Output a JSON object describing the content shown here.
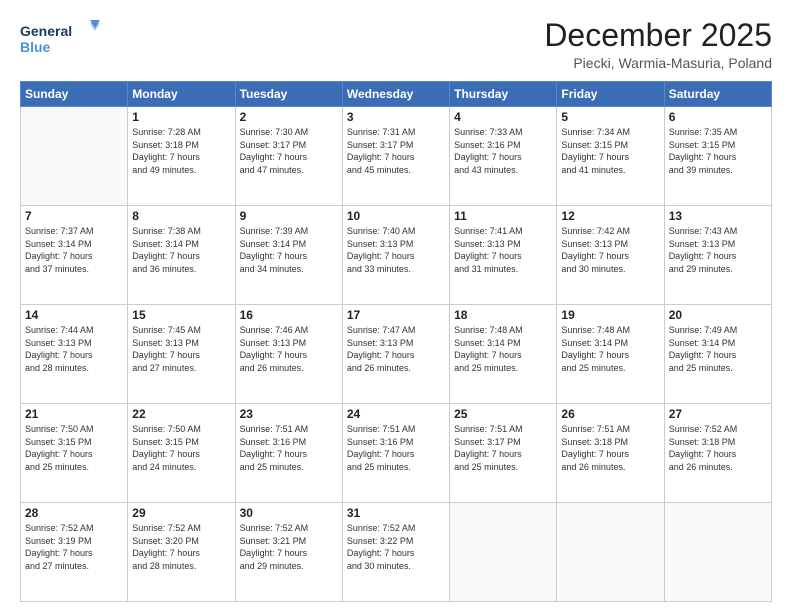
{
  "header": {
    "logo_line1": "General",
    "logo_line2": "Blue",
    "title": "December 2025",
    "subtitle": "Piecki, Warmia-Masuria, Poland"
  },
  "days_of_week": [
    "Sunday",
    "Monday",
    "Tuesday",
    "Wednesday",
    "Thursday",
    "Friday",
    "Saturday"
  ],
  "weeks": [
    [
      {
        "day": "",
        "info": ""
      },
      {
        "day": "1",
        "info": "Sunrise: 7:28 AM\nSunset: 3:18 PM\nDaylight: 7 hours\nand 49 minutes."
      },
      {
        "day": "2",
        "info": "Sunrise: 7:30 AM\nSunset: 3:17 PM\nDaylight: 7 hours\nand 47 minutes."
      },
      {
        "day": "3",
        "info": "Sunrise: 7:31 AM\nSunset: 3:17 PM\nDaylight: 7 hours\nand 45 minutes."
      },
      {
        "day": "4",
        "info": "Sunrise: 7:33 AM\nSunset: 3:16 PM\nDaylight: 7 hours\nand 43 minutes."
      },
      {
        "day": "5",
        "info": "Sunrise: 7:34 AM\nSunset: 3:15 PM\nDaylight: 7 hours\nand 41 minutes."
      },
      {
        "day": "6",
        "info": "Sunrise: 7:35 AM\nSunset: 3:15 PM\nDaylight: 7 hours\nand 39 minutes."
      }
    ],
    [
      {
        "day": "7",
        "info": "Sunrise: 7:37 AM\nSunset: 3:14 PM\nDaylight: 7 hours\nand 37 minutes."
      },
      {
        "day": "8",
        "info": "Sunrise: 7:38 AM\nSunset: 3:14 PM\nDaylight: 7 hours\nand 36 minutes."
      },
      {
        "day": "9",
        "info": "Sunrise: 7:39 AM\nSunset: 3:14 PM\nDaylight: 7 hours\nand 34 minutes."
      },
      {
        "day": "10",
        "info": "Sunrise: 7:40 AM\nSunset: 3:13 PM\nDaylight: 7 hours\nand 33 minutes."
      },
      {
        "day": "11",
        "info": "Sunrise: 7:41 AM\nSunset: 3:13 PM\nDaylight: 7 hours\nand 31 minutes."
      },
      {
        "day": "12",
        "info": "Sunrise: 7:42 AM\nSunset: 3:13 PM\nDaylight: 7 hours\nand 30 minutes."
      },
      {
        "day": "13",
        "info": "Sunrise: 7:43 AM\nSunset: 3:13 PM\nDaylight: 7 hours\nand 29 minutes."
      }
    ],
    [
      {
        "day": "14",
        "info": "Sunrise: 7:44 AM\nSunset: 3:13 PM\nDaylight: 7 hours\nand 28 minutes."
      },
      {
        "day": "15",
        "info": "Sunrise: 7:45 AM\nSunset: 3:13 PM\nDaylight: 7 hours\nand 27 minutes."
      },
      {
        "day": "16",
        "info": "Sunrise: 7:46 AM\nSunset: 3:13 PM\nDaylight: 7 hours\nand 26 minutes."
      },
      {
        "day": "17",
        "info": "Sunrise: 7:47 AM\nSunset: 3:13 PM\nDaylight: 7 hours\nand 26 minutes."
      },
      {
        "day": "18",
        "info": "Sunrise: 7:48 AM\nSunset: 3:14 PM\nDaylight: 7 hours\nand 25 minutes."
      },
      {
        "day": "19",
        "info": "Sunrise: 7:48 AM\nSunset: 3:14 PM\nDaylight: 7 hours\nand 25 minutes."
      },
      {
        "day": "20",
        "info": "Sunrise: 7:49 AM\nSunset: 3:14 PM\nDaylight: 7 hours\nand 25 minutes."
      }
    ],
    [
      {
        "day": "21",
        "info": "Sunrise: 7:50 AM\nSunset: 3:15 PM\nDaylight: 7 hours\nand 25 minutes."
      },
      {
        "day": "22",
        "info": "Sunrise: 7:50 AM\nSunset: 3:15 PM\nDaylight: 7 hours\nand 24 minutes."
      },
      {
        "day": "23",
        "info": "Sunrise: 7:51 AM\nSunset: 3:16 PM\nDaylight: 7 hours\nand 25 minutes."
      },
      {
        "day": "24",
        "info": "Sunrise: 7:51 AM\nSunset: 3:16 PM\nDaylight: 7 hours\nand 25 minutes."
      },
      {
        "day": "25",
        "info": "Sunrise: 7:51 AM\nSunset: 3:17 PM\nDaylight: 7 hours\nand 25 minutes."
      },
      {
        "day": "26",
        "info": "Sunrise: 7:51 AM\nSunset: 3:18 PM\nDaylight: 7 hours\nand 26 minutes."
      },
      {
        "day": "27",
        "info": "Sunrise: 7:52 AM\nSunset: 3:18 PM\nDaylight: 7 hours\nand 26 minutes."
      }
    ],
    [
      {
        "day": "28",
        "info": "Sunrise: 7:52 AM\nSunset: 3:19 PM\nDaylight: 7 hours\nand 27 minutes."
      },
      {
        "day": "29",
        "info": "Sunrise: 7:52 AM\nSunset: 3:20 PM\nDaylight: 7 hours\nand 28 minutes."
      },
      {
        "day": "30",
        "info": "Sunrise: 7:52 AM\nSunset: 3:21 PM\nDaylight: 7 hours\nand 29 minutes."
      },
      {
        "day": "31",
        "info": "Sunrise: 7:52 AM\nSunset: 3:22 PM\nDaylight: 7 hours\nand 30 minutes."
      },
      {
        "day": "",
        "info": ""
      },
      {
        "day": "",
        "info": ""
      },
      {
        "day": "",
        "info": ""
      }
    ]
  ]
}
